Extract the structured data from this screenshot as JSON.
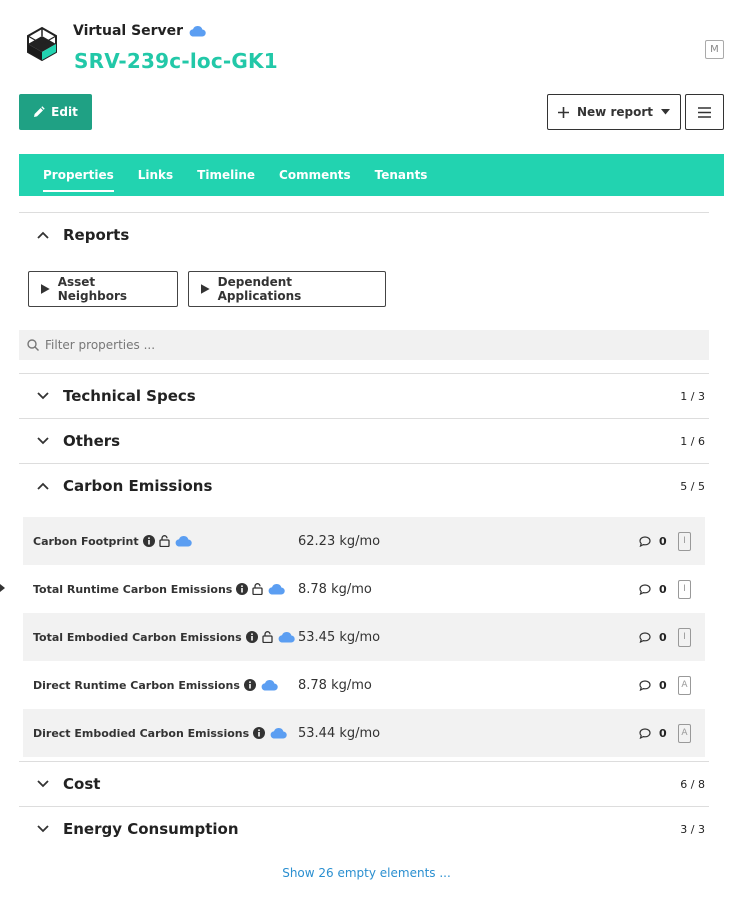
{
  "header": {
    "type_label": "Virtual Server",
    "title": "SRV-239c-loc-GK1",
    "badge": "M"
  },
  "toolbar": {
    "edit_label": "Edit",
    "new_report_label": "New report"
  },
  "tabs": [
    {
      "label": "Properties",
      "active": true
    },
    {
      "label": "Links"
    },
    {
      "label": "Timeline"
    },
    {
      "label": "Comments"
    },
    {
      "label": "Tenants"
    }
  ],
  "reports": {
    "title": "Reports",
    "buttons": [
      {
        "label": "Asset Neighbors"
      },
      {
        "label": "Dependent Applications"
      }
    ]
  },
  "filter": {
    "placeholder": "Filter properties ..."
  },
  "sections": {
    "technical": {
      "title": "Technical Specs",
      "count": "1 / 3"
    },
    "others": {
      "title": "Others",
      "count": "1 / 6"
    },
    "carbon": {
      "title": "Carbon Emissions",
      "count": "5 / 5"
    },
    "cost": {
      "title": "Cost",
      "count": "6 / 8"
    },
    "energy": {
      "title": "Energy Consumption",
      "count": "3 / 3"
    }
  },
  "carbon_rows": [
    {
      "label": "Carbon Footprint",
      "value": "62.23 kg/mo",
      "comments": "0",
      "flag": "I"
    },
    {
      "label": "Total Runtime Carbon Emissions",
      "value": "8.78 kg/mo",
      "comments": "0",
      "flag": "I"
    },
    {
      "label": "Total Embodied Carbon Emissions",
      "value": "53.45 kg/mo",
      "comments": "0",
      "flag": "I"
    },
    {
      "label": "Direct Runtime Carbon Emissions",
      "value": "8.78 kg/mo",
      "comments": "0",
      "flag": "A"
    },
    {
      "label": "Direct Embodied Carbon Emissions",
      "value": "53.44 kg/mo",
      "comments": "0",
      "flag": "A"
    }
  ],
  "show_empty_label": "Show 26 empty elements ...",
  "colors": {
    "accent": "#22d3b0",
    "title": "#22c8a8",
    "edit_button": "#1fa184",
    "cloud": "#5b9ef2",
    "link": "#2a8fd0"
  }
}
